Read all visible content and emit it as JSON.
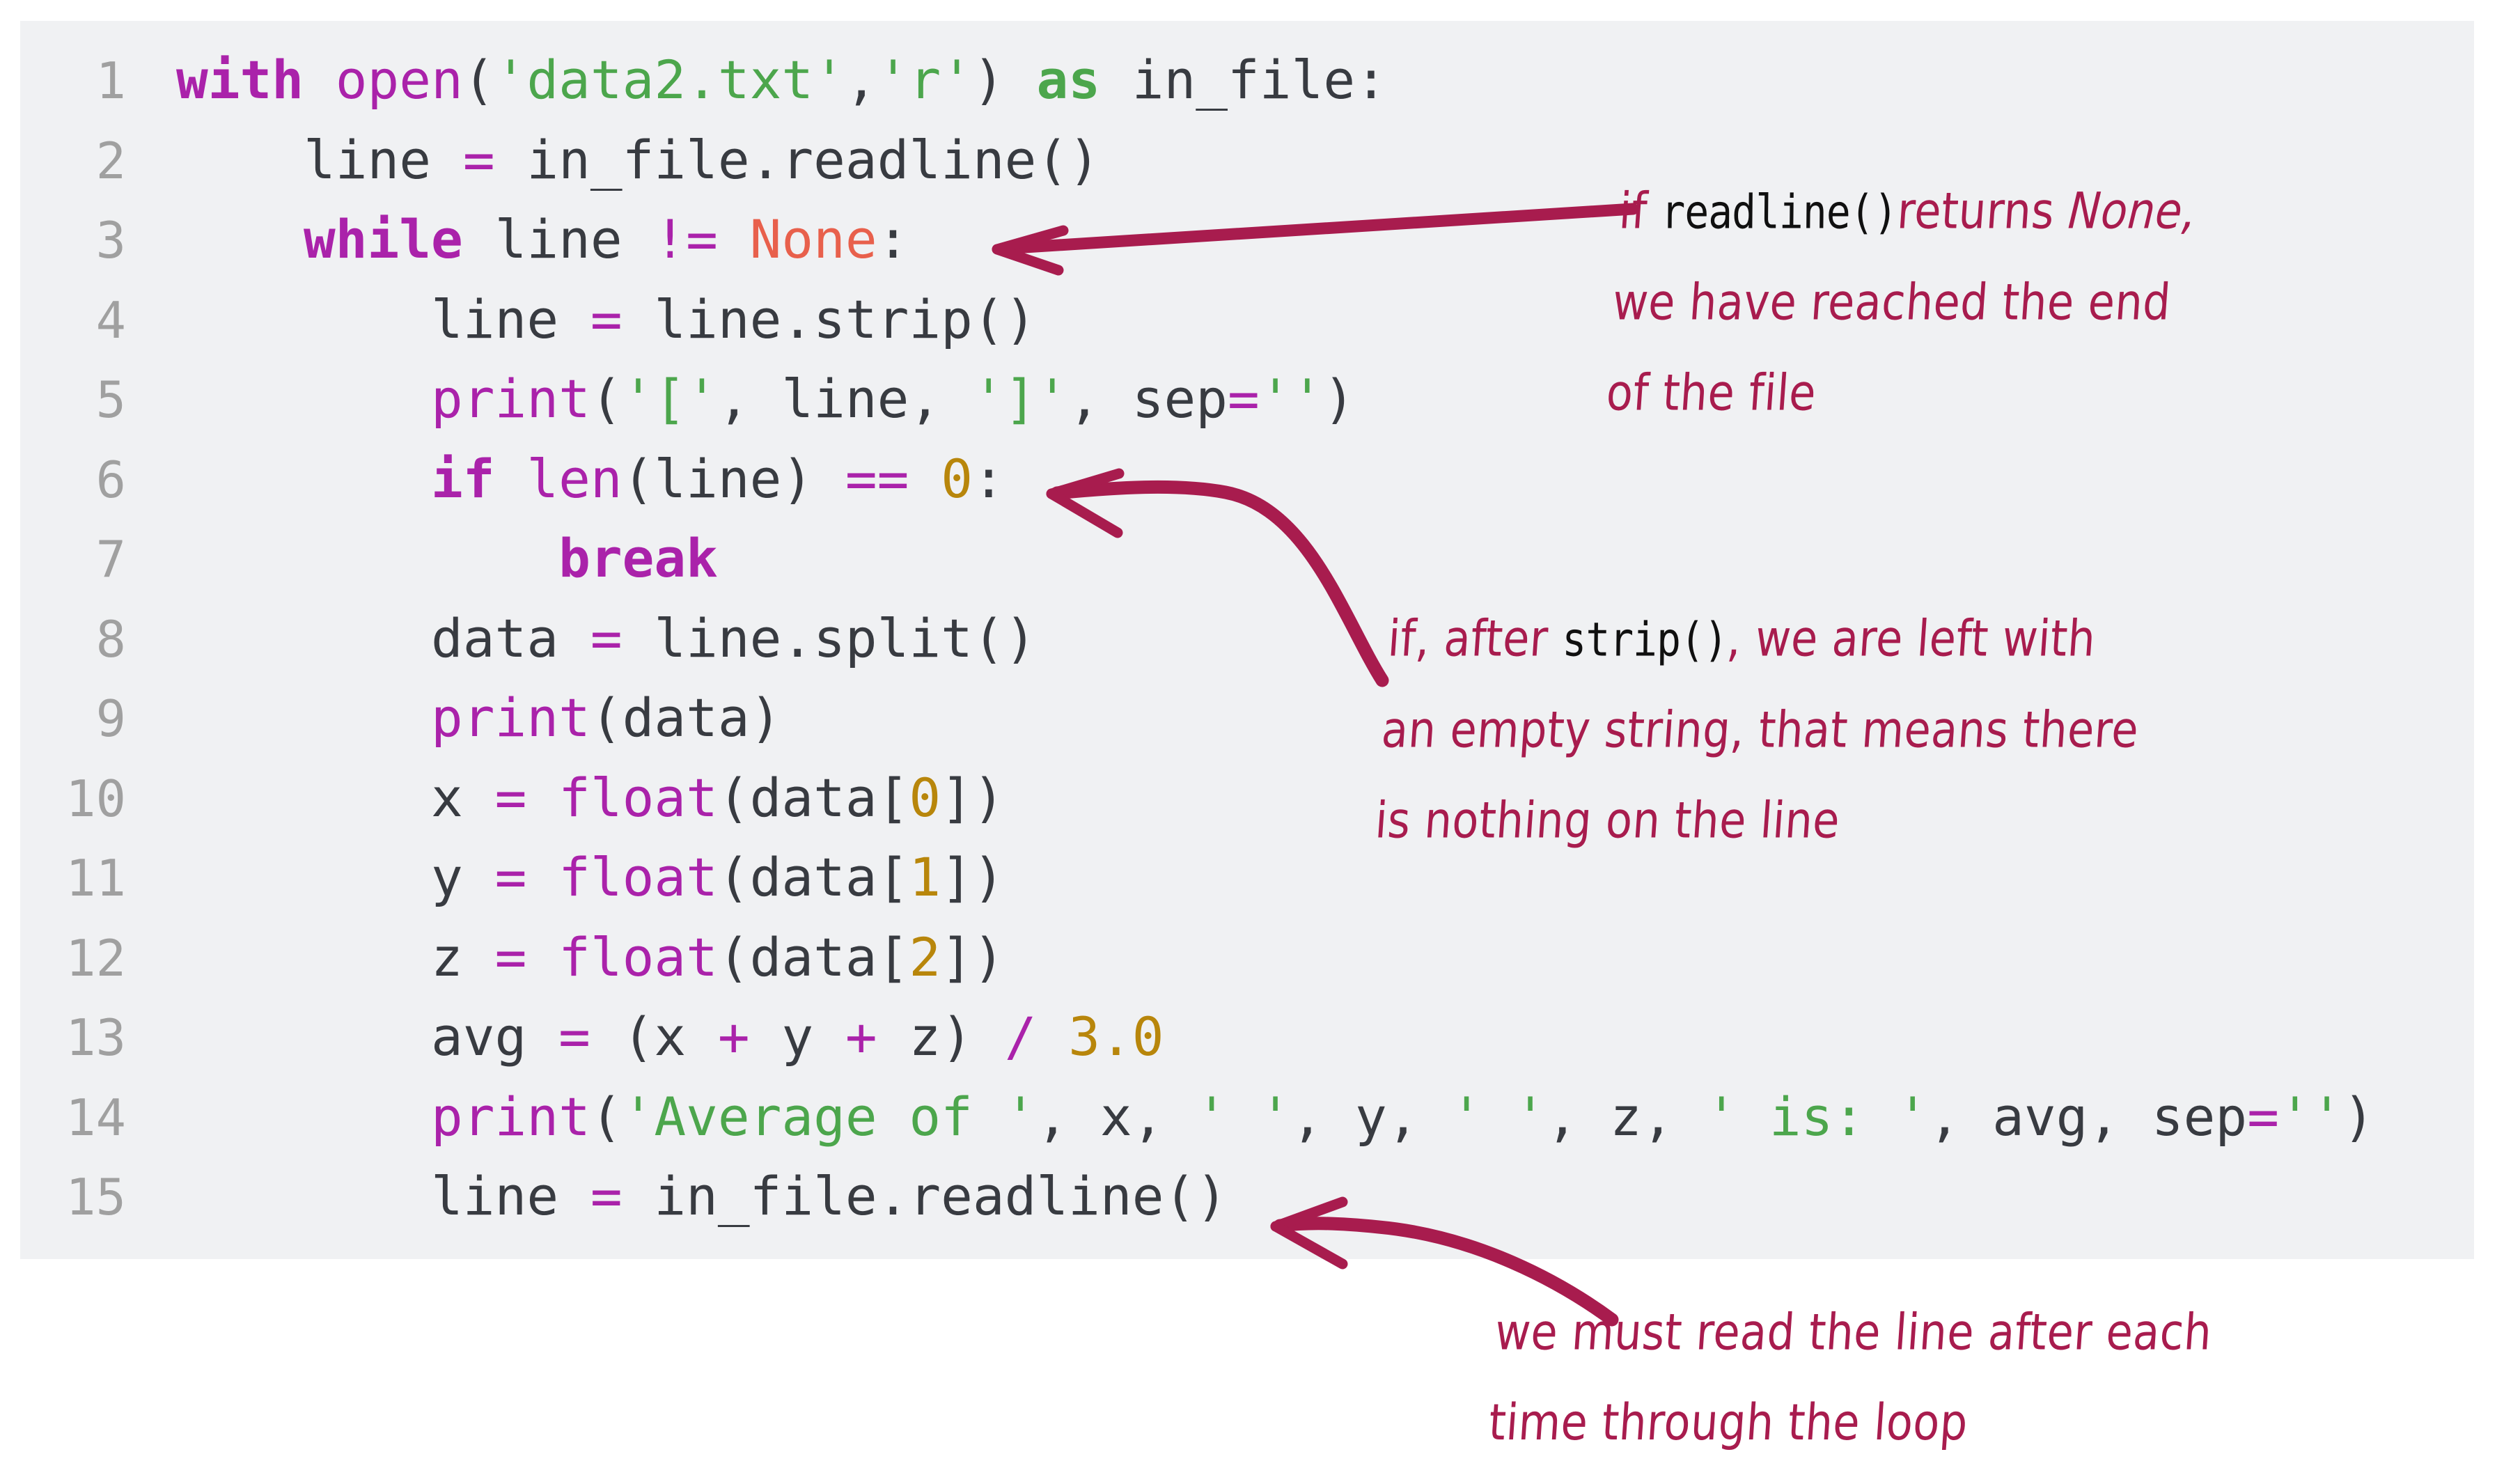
{
  "code_block": {
    "background_color": "#f0f1f3",
    "language": "python",
    "line_numbers": [
      "1",
      "2",
      "3",
      "4",
      "5",
      "6",
      "7",
      "8",
      "9",
      "10",
      "11",
      "12",
      "13",
      "14",
      "15"
    ],
    "lines": [
      {
        "n": "1",
        "text": "with open('data2.txt','r') as in_file:"
      },
      {
        "n": "2",
        "text": "    line = in_file.readline()"
      },
      {
        "n": "3",
        "text": "    while line != None:"
      },
      {
        "n": "4",
        "text": "        line = line.strip()"
      },
      {
        "n": "5",
        "text": "        print('[', line, ']', sep='')"
      },
      {
        "n": "6",
        "text": "        if len(line) == 0:"
      },
      {
        "n": "7",
        "text": "            break"
      },
      {
        "n": "8",
        "text": "        data = line.split()"
      },
      {
        "n": "9",
        "text": "        print(data)"
      },
      {
        "n": "10",
        "text": "        x = float(data[0])"
      },
      {
        "n": "11",
        "text": "        y = float(data[1])"
      },
      {
        "n": "12",
        "text": "        z = float(data[2])"
      },
      {
        "n": "13",
        "text": "        avg = (x + y + z) / 3.0"
      },
      {
        "n": "14",
        "text": "        print('Average of ', x, ' ', y, ' ', z, ' is: ', avg, sep='')"
      },
      {
        "n": "15",
        "text": "        line = in_file.readline()"
      }
    ],
    "colors": {
      "keyword": "#aa22aa",
      "keyword_as": "#4ca64c",
      "builtin": "#aa22aa",
      "string": "#4ca64c",
      "number": "#b8860b",
      "operator": "#aa22aa",
      "none_literal": "#e8604c",
      "plain": "#383b41",
      "line_number": "#a0a0a0"
    }
  },
  "annotations": {
    "color": "#a81c4e",
    "items": [
      {
        "id": "annotation-readline-none",
        "target_line": "3",
        "arrow": "straight-left-arrow",
        "lines": [
          {
            "parts": [
              {
                "t": "if ",
                "style": "hand"
              },
              {
                "t": "readline()",
                "style": "mono"
              },
              {
                "t": "returns ",
                "style": "hand"
              },
              {
                "t": "None,",
                "style": "hand-italic"
              }
            ]
          },
          {
            "parts": [
              {
                "t": "we have reached the end",
                "style": "hand"
              }
            ]
          },
          {
            "parts": [
              {
                "t": "of the file",
                "style": "hand"
              }
            ]
          }
        ]
      },
      {
        "id": "annotation-strip-empty",
        "target_line": "6",
        "arrow": "curved-left-arrow",
        "lines": [
          {
            "parts": [
              {
                "t": "if, after ",
                "style": "hand"
              },
              {
                "t": "strip()",
                "style": "mono"
              },
              {
                "t": ", we are left with",
                "style": "hand"
              }
            ]
          },
          {
            "parts": [
              {
                "t": "an empty string, that means there",
                "style": "hand"
              }
            ]
          },
          {
            "parts": [
              {
                "t": "is nothing on the line",
                "style": "hand"
              }
            ]
          }
        ]
      },
      {
        "id": "annotation-read-each-loop",
        "target_line": "15",
        "arrow": "curved-left-arrow-bottom",
        "lines": [
          {
            "parts": [
              {
                "t": "we must read the line after each",
                "style": "hand"
              }
            ]
          },
          {
            "parts": [
              {
                "t": "time through the loop",
                "style": "hand"
              }
            ]
          }
        ]
      }
    ]
  }
}
